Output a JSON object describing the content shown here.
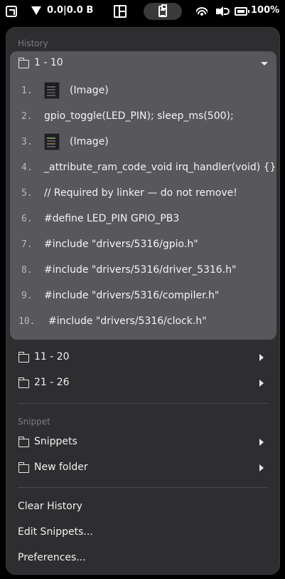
{
  "status_bar": {
    "net_speed": "0.0|0.0 B",
    "battery": "100%",
    "icons": [
      "app-icon",
      "download-icon",
      "grid-icon",
      "clipboard-icon",
      "wifi-icon",
      "volume-icon",
      "battery-icon"
    ]
  },
  "history": {
    "title": "History",
    "expanded_group": {
      "label": "1 - 10",
      "items": [
        {
          "num": "1.",
          "text": "(Image)",
          "type": "image"
        },
        {
          "num": "2.",
          "text": "gpio_toggle(LED_PIN); sleep_ms(500);",
          "type": "text"
        },
        {
          "num": "3.",
          "text": "(Image)",
          "type": "image"
        },
        {
          "num": "4.",
          "text": "_attribute_ram_code_void irq_handler(void) {}",
          "type": "text"
        },
        {
          "num": "5.",
          "text": "// Required by linker — do not remove!",
          "type": "text"
        },
        {
          "num": "6.",
          "text": "#define LED_PIN GPIO_PB3",
          "type": "text"
        },
        {
          "num": "7.",
          "text": "#include \"drivers/5316/gpio.h\"",
          "type": "text"
        },
        {
          "num": "8.",
          "text": "#include \"drivers/5316/driver_5316.h\"",
          "type": "text"
        },
        {
          "num": "9.",
          "text": "#include \"drivers/5316/compiler.h\"",
          "type": "text"
        },
        {
          "num": "10.",
          "text": "#include \"drivers/5316/clock.h\"",
          "type": "text"
        }
      ]
    },
    "groups": [
      {
        "label": "11 - 20"
      },
      {
        "label": "21 - 26"
      }
    ]
  },
  "snippet": {
    "title": "Snippet",
    "folders": [
      {
        "label": "Snippets"
      },
      {
        "label": "New folder"
      }
    ]
  },
  "actions": {
    "clear_history": "Clear History",
    "edit_snippets": "Edit Snippets...",
    "preferences": "Preferences..."
  }
}
